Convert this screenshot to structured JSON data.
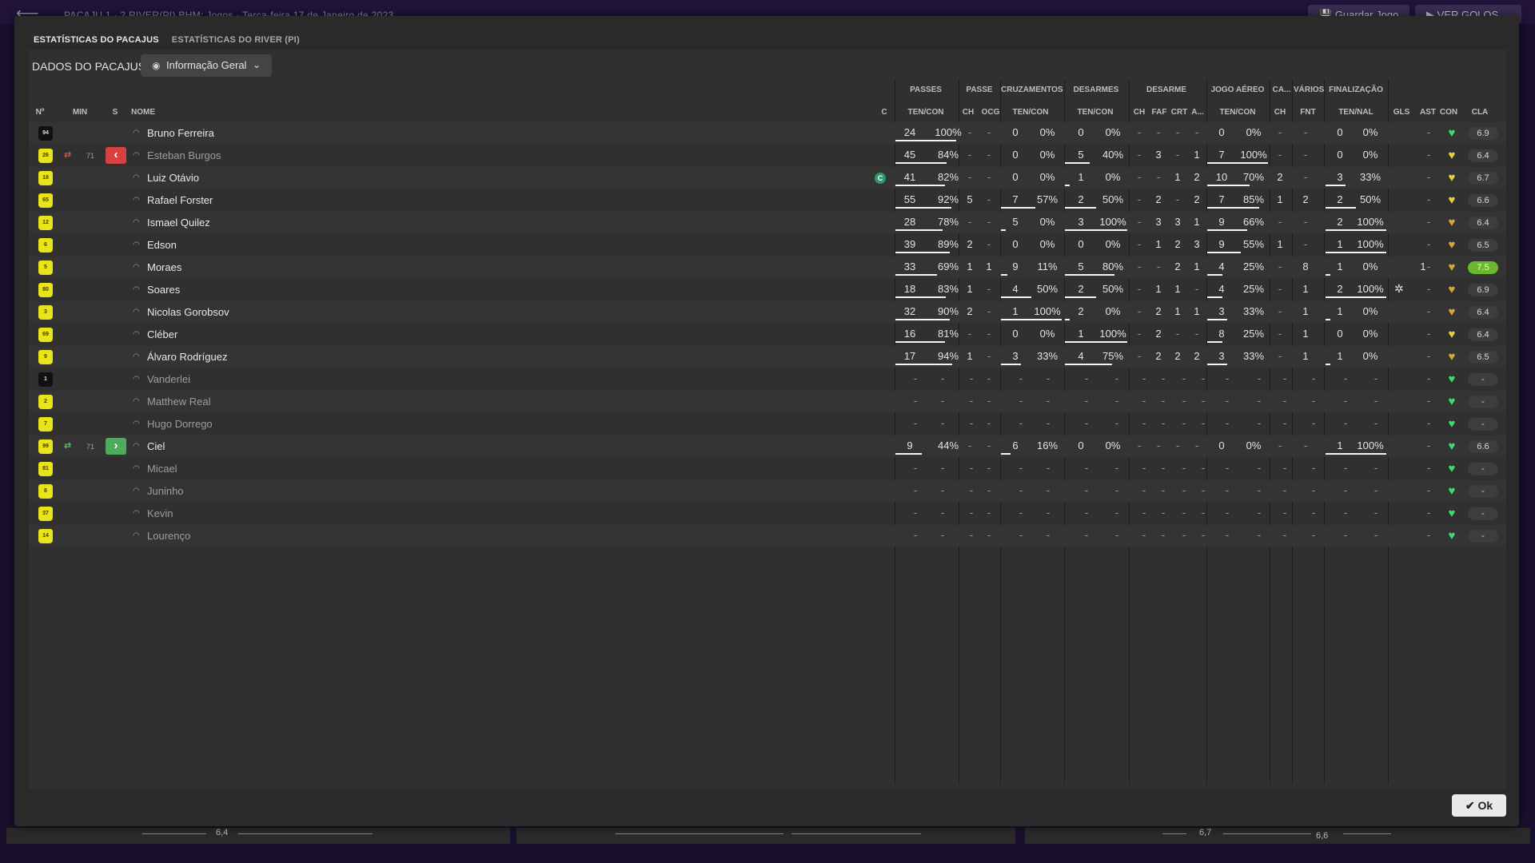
{
  "topbar": {
    "title": "PACAJU 1 - 2 RIVER(PI)  BHM: Jogos  ·  Terça-feira 17 de Janeiro de 2023",
    "save_label": "Guardar Jogo",
    "goals_label": "VER GOLOS"
  },
  "bottom_strip": {
    "left_value": "6,4",
    "mid_value": "6,7",
    "right_value": "6,6"
  },
  "tabs": [
    "ESTATÍSTICAS DO PACAJUS",
    "ESTATÍSTICAS DO RIVER (PI)"
  ],
  "toolbar": {
    "label": "DADOS DO PACAJUS",
    "dropdown": "Informação Geral"
  },
  "groups": [
    "PASSES",
    "PASSE",
    "CRUZAMENTOS",
    "DESARMES",
    "DESARME",
    "JOGO AÉREO",
    "CA...",
    "VÁRIOS",
    "FINALIZAÇÃO"
  ],
  "headers": {
    "no": "Nº",
    "min": "MIN",
    "s": "S",
    "name": "NOME",
    "c": "C",
    "passes": "TEN/CON",
    "ch1": "CH",
    "ocg": "OCG",
    "crosses": "TEN/CON",
    "tackles": "TEN/CON",
    "ch2": "CH",
    "faf": "FAF",
    "crt": "CRT",
    "a": "A...",
    "aerial": "TEN/CON",
    "ch3": "CH",
    "fnt": "FNT",
    "shots": "TEN/NAL",
    "gls": "GLS",
    "ast": "AST",
    "con": "CON",
    "cla": "CLA"
  },
  "players": [
    {
      "no": "94",
      "gk": true,
      "name": "Bruno Ferreira",
      "dim": false,
      "sub": "",
      "submin": "",
      "capt": false,
      "p": [
        "24",
        "100%"
      ],
      "ch1": "-",
      "ocg": "-",
      "cr": [
        "0",
        "0%"
      ],
      "tk": [
        "0",
        "0%"
      ],
      "ch2": "-",
      "faf": "-",
      "crt": "-",
      "a": "-",
      "ae": [
        "0",
        "0%"
      ],
      "ch3": "-",
      "fnt": "-",
      "sh": [
        "0",
        "0%"
      ],
      "gls": "",
      "ast": "-",
      "heart": "green",
      "cla": "6.9",
      "best": false,
      "motm": false
    },
    {
      "no": "26",
      "gk": false,
      "name": "Esteban Burgos",
      "dim": true,
      "sub": "out",
      "submin": "71",
      "capt": false,
      "p": [
        "45",
        "84%"
      ],
      "ch1": "-",
      "ocg": "-",
      "cr": [
        "0",
        "0%"
      ],
      "tk": [
        "5",
        "40%"
      ],
      "ch2": "-",
      "faf": "3",
      "crt": "-",
      "a": "1",
      "ae": [
        "7",
        "100%"
      ],
      "ch3": "-",
      "fnt": "-",
      "sh": [
        "0",
        "0%"
      ],
      "gls": "",
      "ast": "-",
      "heart": "yellow",
      "cla": "6.4",
      "best": false,
      "motm": false
    },
    {
      "no": "18",
      "gk": false,
      "name": "Luiz Otávio",
      "dim": false,
      "sub": "",
      "submin": "",
      "capt": true,
      "p": [
        "41",
        "82%"
      ],
      "ch1": "-",
      "ocg": "-",
      "cr": [
        "0",
        "0%"
      ],
      "tk": [
        "1",
        "0%"
      ],
      "ch2": "-",
      "faf": "-",
      "crt": "1",
      "a": "2",
      "ae": [
        "10",
        "70%"
      ],
      "ch3": "2",
      "fnt": "-",
      "sh": [
        "3",
        "33%"
      ],
      "gls": "",
      "ast": "-",
      "heart": "yellow",
      "cla": "6.7",
      "best": false,
      "motm": false
    },
    {
      "no": "65",
      "gk": false,
      "name": "Rafael Forster",
      "dim": false,
      "sub": "",
      "submin": "",
      "capt": false,
      "p": [
        "55",
        "92%"
      ],
      "ch1": "5",
      "ocg": "-",
      "cr": [
        "7",
        "57%"
      ],
      "tk": [
        "2",
        "50%"
      ],
      "ch2": "-",
      "faf": "2",
      "crt": "-",
      "a": "2",
      "ae": [
        "7",
        "85%"
      ],
      "ch3": "1",
      "fnt": "2",
      "sh": [
        "2",
        "50%"
      ],
      "gls": "",
      "ast": "-",
      "heart": "yellow",
      "cla": "6.6",
      "best": false,
      "motm": false
    },
    {
      "no": "12",
      "gk": false,
      "name": "Ismael Quilez",
      "dim": false,
      "sub": "",
      "submin": "",
      "capt": false,
      "p": [
        "28",
        "78%"
      ],
      "ch1": "-",
      "ocg": "-",
      "cr": [
        "5",
        "0%"
      ],
      "tk": [
        "3",
        "100%"
      ],
      "ch2": "-",
      "faf": "3",
      "crt": "3",
      "a": "1",
      "ae": [
        "9",
        "66%"
      ],
      "ch3": "-",
      "fnt": "-",
      "sh": [
        "2",
        "100%"
      ],
      "gls": "",
      "ast": "-",
      "heart": "orange",
      "cla": "6.4",
      "best": false,
      "motm": false
    },
    {
      "no": "6",
      "gk": false,
      "name": "Edson",
      "dim": false,
      "sub": "",
      "submin": "",
      "capt": false,
      "p": [
        "39",
        "89%"
      ],
      "ch1": "2",
      "ocg": "-",
      "cr": [
        "0",
        "0%"
      ],
      "tk": [
        "0",
        "0%"
      ],
      "ch2": "-",
      "faf": "1",
      "crt": "2",
      "a": "3",
      "ae": [
        "9",
        "55%"
      ],
      "ch3": "1",
      "fnt": "-",
      "sh": [
        "1",
        "100%"
      ],
      "gls": "",
      "ast": "-",
      "heart": "orange",
      "cla": "6.5",
      "best": false,
      "motm": false
    },
    {
      "no": "5",
      "gk": false,
      "name": "Moraes",
      "dim": false,
      "sub": "",
      "submin": "",
      "capt": false,
      "p": [
        "33",
        "69%"
      ],
      "ch1": "1",
      "ocg": "1",
      "cr": [
        "9",
        "11%"
      ],
      "tk": [
        "5",
        "80%"
      ],
      "ch2": "-",
      "faf": "-",
      "crt": "2",
      "a": "1",
      "ae": [
        "4",
        "25%"
      ],
      "ch3": "-",
      "fnt": "8",
      "sh": [
        "1",
        "0%"
      ],
      "gls": "1",
      "ast": "-",
      "heart": "orange",
      "cla": "7.5",
      "best": true,
      "motm": false
    },
    {
      "no": "80",
      "gk": false,
      "name": "Soares",
      "dim": false,
      "sub": "",
      "submin": "",
      "capt": false,
      "p": [
        "18",
        "83%"
      ],
      "ch1": "1",
      "ocg": "-",
      "cr": [
        "4",
        "50%"
      ],
      "tk": [
        "2",
        "50%"
      ],
      "ch2": "-",
      "faf": "1",
      "crt": "1",
      "a": "-",
      "ae": [
        "4",
        "25%"
      ],
      "ch3": "-",
      "fnt": "1",
      "sh": [
        "2",
        "100%"
      ],
      "gls": "",
      "ast": "-",
      "heart": "orange",
      "cla": "6.9",
      "best": false,
      "motm": true
    },
    {
      "no": "3",
      "gk": false,
      "name": "Nicolas Gorobsov",
      "dim": false,
      "sub": "",
      "submin": "",
      "capt": false,
      "p": [
        "32",
        "90%"
      ],
      "ch1": "2",
      "ocg": "-",
      "cr": [
        "1",
        "100%"
      ],
      "tk": [
        "2",
        "0%"
      ],
      "ch2": "-",
      "faf": "2",
      "crt": "1",
      "a": "1",
      "ae": [
        "3",
        "33%"
      ],
      "ch3": "-",
      "fnt": "1",
      "sh": [
        "1",
        "0%"
      ],
      "gls": "",
      "ast": "-",
      "heart": "orange",
      "cla": "6.4",
      "best": false,
      "motm": false
    },
    {
      "no": "69",
      "gk": false,
      "name": "Cléber",
      "dim": false,
      "sub": "",
      "submin": "",
      "capt": false,
      "p": [
        "16",
        "81%"
      ],
      "ch1": "-",
      "ocg": "-",
      "cr": [
        "0",
        "0%"
      ],
      "tk": [
        "1",
        "100%"
      ],
      "ch2": "-",
      "faf": "2",
      "crt": "-",
      "a": "-",
      "ae": [
        "8",
        "25%"
      ],
      "ch3": "-",
      "fnt": "1",
      "sh": [
        "0",
        "0%"
      ],
      "gls": "",
      "ast": "-",
      "heart": "yellow",
      "cla": "6.4",
      "best": false,
      "motm": false
    },
    {
      "no": "9",
      "gk": false,
      "name": "Álvaro Rodríguez",
      "dim": false,
      "sub": "",
      "submin": "",
      "capt": false,
      "p": [
        "17",
        "94%"
      ],
      "ch1": "1",
      "ocg": "-",
      "cr": [
        "3",
        "33%"
      ],
      "tk": [
        "4",
        "75%"
      ],
      "ch2": "-",
      "faf": "2",
      "crt": "2",
      "a": "2",
      "ae": [
        "3",
        "33%"
      ],
      "ch3": "-",
      "fnt": "1",
      "sh": [
        "1",
        "0%"
      ],
      "gls": "",
      "ast": "-",
      "heart": "orange",
      "cla": "6.5",
      "best": false,
      "motm": false
    },
    {
      "no": "1",
      "gk": true,
      "name": "Vanderlei",
      "dim": true,
      "sub": "",
      "submin": "",
      "capt": false,
      "empty": true,
      "heart": "green",
      "cla": "-"
    },
    {
      "no": "2",
      "gk": false,
      "name": "Matthew Real",
      "dim": true,
      "sub": "",
      "submin": "",
      "capt": false,
      "empty": true,
      "heart": "green",
      "cla": "-"
    },
    {
      "no": "7",
      "gk": false,
      "name": "Hugo Dorrego",
      "dim": true,
      "sub": "",
      "submin": "",
      "capt": false,
      "empty": true,
      "heart": "green",
      "cla": "-"
    },
    {
      "no": "99",
      "gk": false,
      "name": "Ciel",
      "dim": false,
      "sub": "in",
      "submin": "71",
      "capt": false,
      "p": [
        "9",
        "44%"
      ],
      "ch1": "-",
      "ocg": "-",
      "cr": [
        "6",
        "16%"
      ],
      "tk": [
        "0",
        "0%"
      ],
      "ch2": "-",
      "faf": "-",
      "crt": "-",
      "a": "-",
      "ae": [
        "0",
        "0%"
      ],
      "ch3": "-",
      "fnt": "-",
      "sh": [
        "1",
        "100%"
      ],
      "gls": "",
      "ast": "-",
      "heart": "green",
      "cla": "6.6",
      "best": false,
      "motm": false
    },
    {
      "no": "81",
      "gk": false,
      "name": "Micael",
      "dim": true,
      "sub": "",
      "submin": "",
      "capt": false,
      "empty": true,
      "heart": "green",
      "cla": "-"
    },
    {
      "no": "8",
      "gk": false,
      "name": "Juninho",
      "dim": true,
      "sub": "",
      "submin": "",
      "capt": false,
      "empty": true,
      "heart": "green",
      "cla": "-"
    },
    {
      "no": "37",
      "gk": false,
      "name": "Kevin",
      "dim": true,
      "sub": "",
      "submin": "",
      "capt": false,
      "empty": true,
      "heart": "green",
      "cla": "-"
    },
    {
      "no": "14",
      "gk": false,
      "name": "Lourenço",
      "dim": true,
      "sub": "",
      "submin": "",
      "capt": false,
      "empty": true,
      "heart": "green",
      "cla": "-"
    }
  ],
  "ok_label": "Ok",
  "colors": {
    "heart_green": "#3ddc6a",
    "heart_yellow": "#e6d23a",
    "heart_orange": "#d9a63a",
    "best_rating": "#69b82e"
  }
}
